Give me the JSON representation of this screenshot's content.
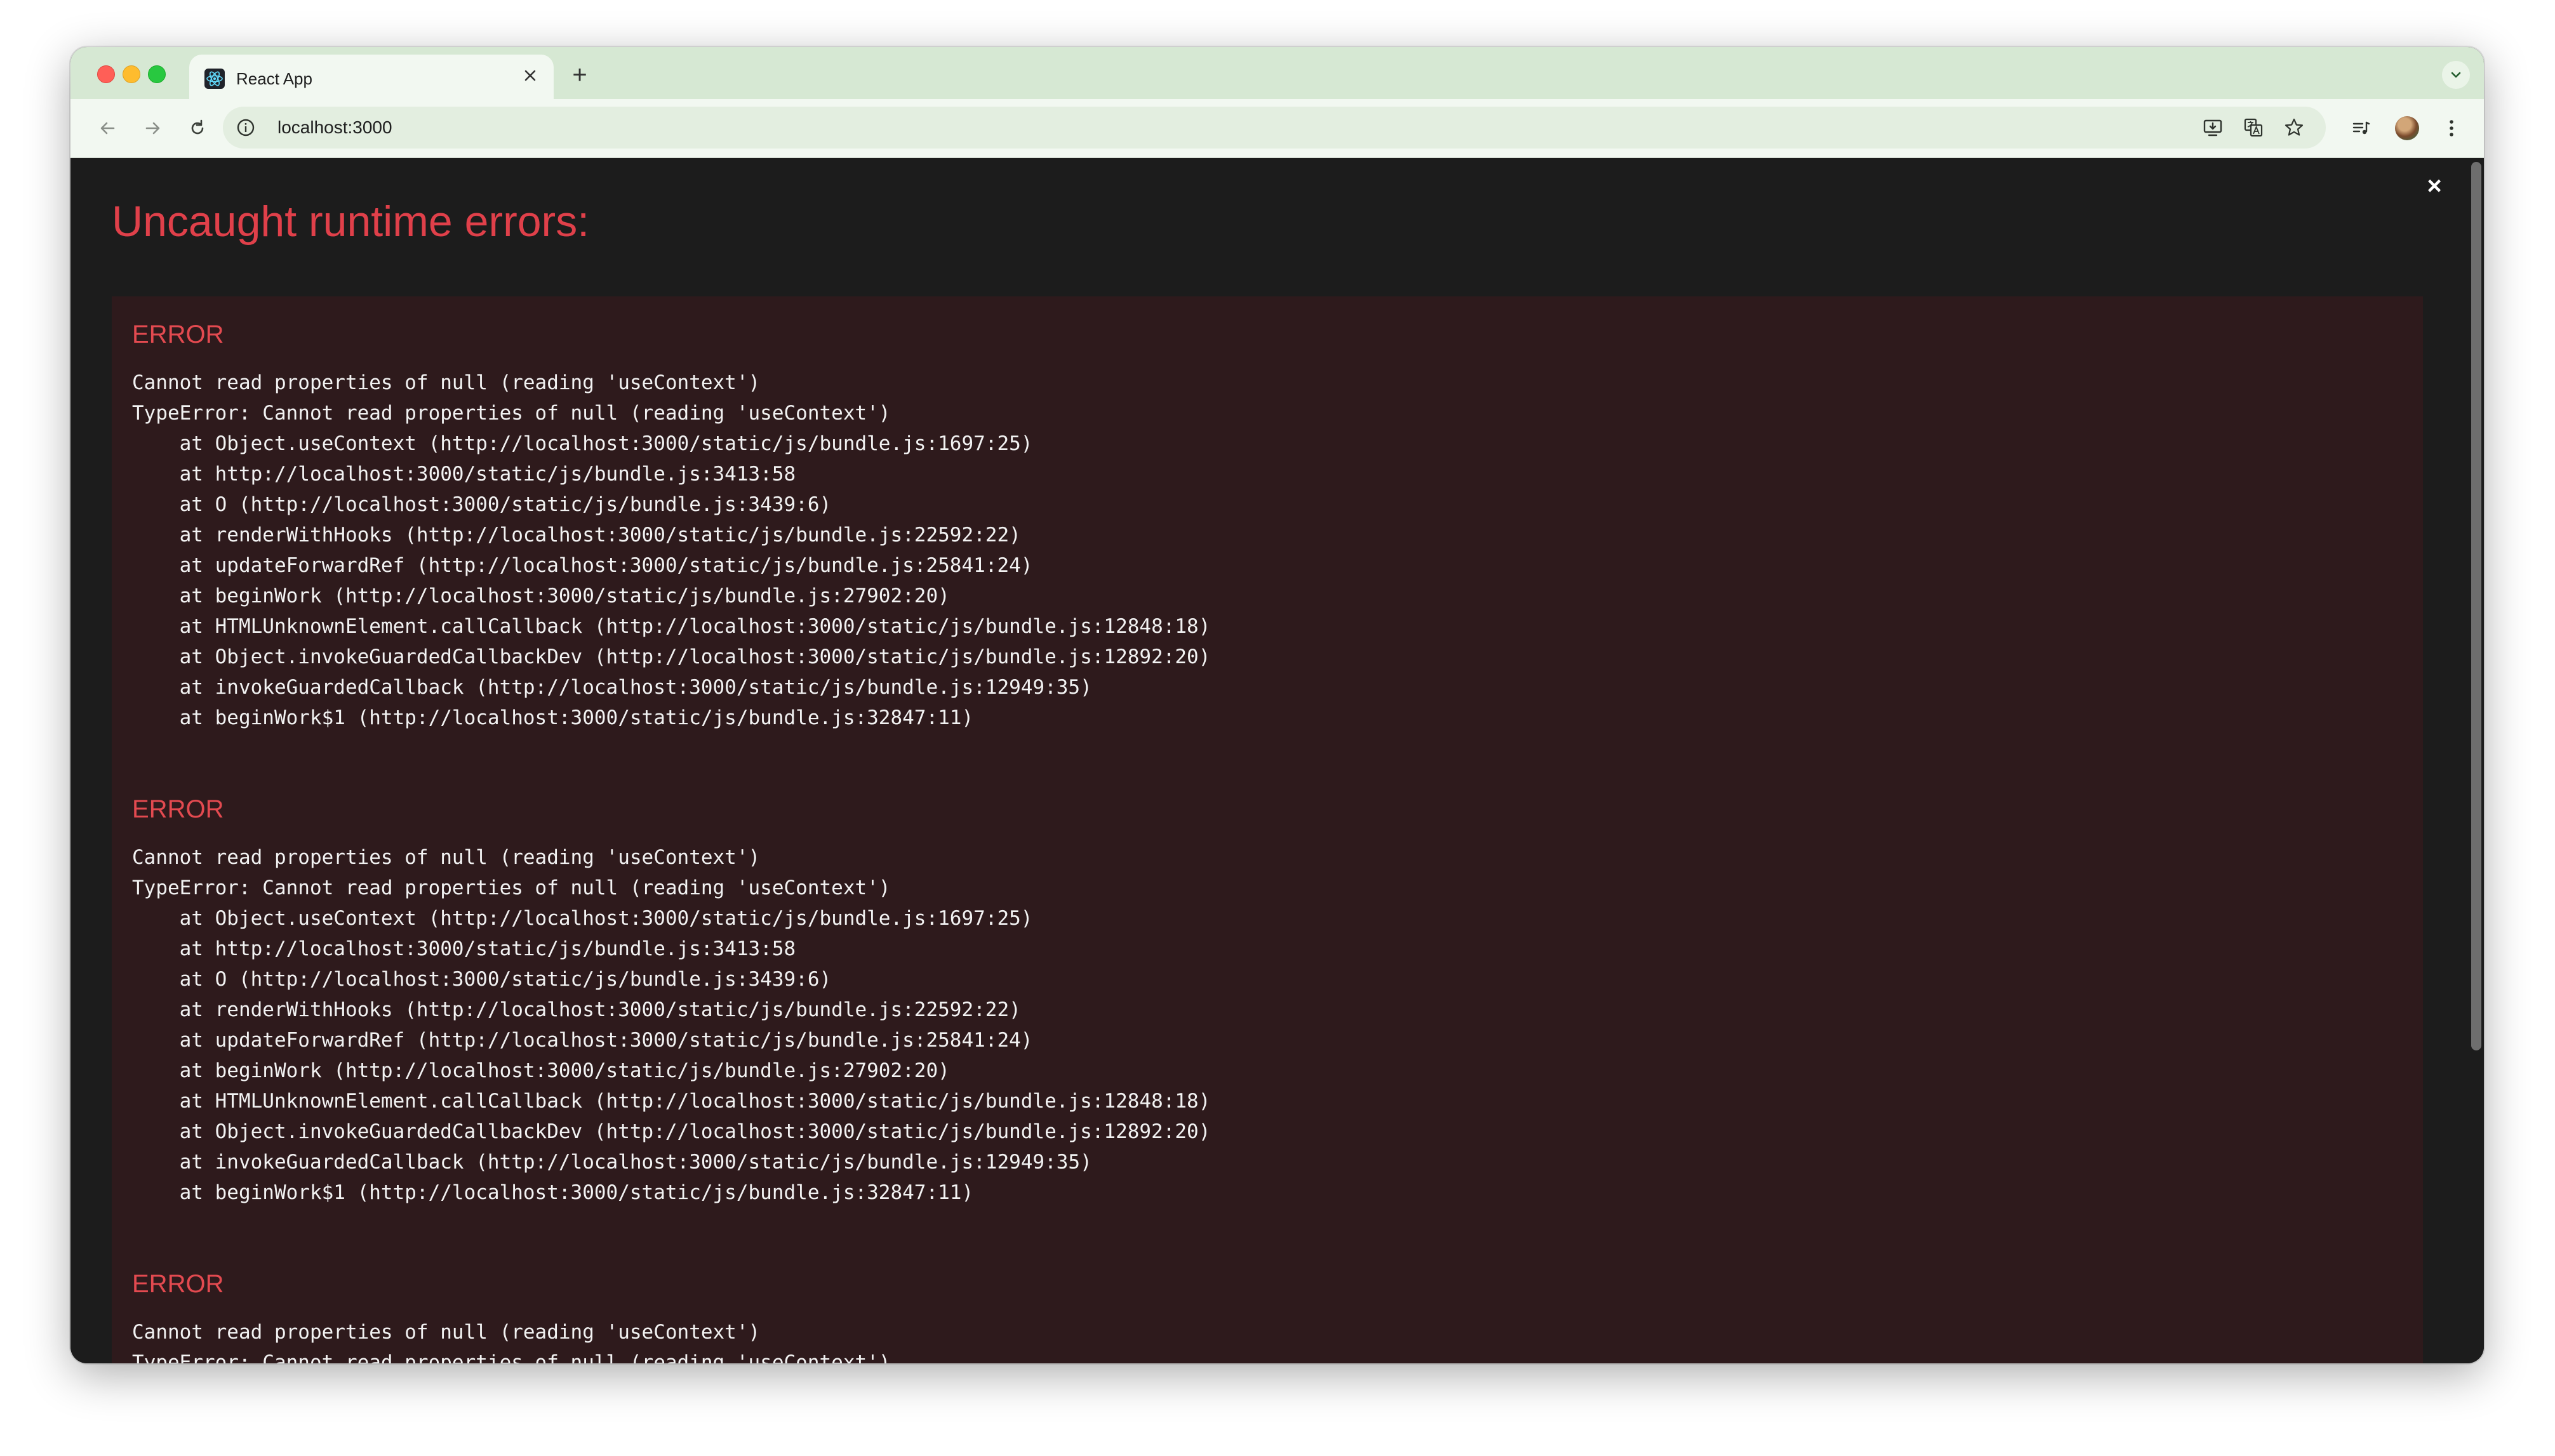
{
  "browser": {
    "tab": {
      "title": "React App",
      "favicon": "react-logo-icon"
    },
    "new_tab_label": "+",
    "address": "localhost:3000",
    "icons": {
      "back": "back-arrow-icon",
      "forward": "forward-arrow-icon",
      "reload": "reload-icon",
      "site_info": "info-icon",
      "install": "install-app-icon",
      "translate": "translate-icon",
      "bookmark": "star-icon",
      "reading_list": "reading-list-icon",
      "profile": "avatar",
      "menu": "kebab-menu-icon"
    }
  },
  "overlay": {
    "title": "Uncaught runtime errors:",
    "close_label": "×",
    "errors": [
      {
        "heading": "ERROR",
        "message": "Cannot read properties of null (reading 'useContext')",
        "type_line": "TypeError: Cannot read properties of null (reading 'useContext')",
        "stack": [
          "    at Object.useContext (http://localhost:3000/static/js/bundle.js:1697:25)",
          "    at http://localhost:3000/static/js/bundle.js:3413:58",
          "    at O (http://localhost:3000/static/js/bundle.js:3439:6)",
          "    at renderWithHooks (http://localhost:3000/static/js/bundle.js:22592:22)",
          "    at updateForwardRef (http://localhost:3000/static/js/bundle.js:25841:24)",
          "    at beginWork (http://localhost:3000/static/js/bundle.js:27902:20)",
          "    at HTMLUnknownElement.callCallback (http://localhost:3000/static/js/bundle.js:12848:18)",
          "    at Object.invokeGuardedCallbackDev (http://localhost:3000/static/js/bundle.js:12892:20)",
          "    at invokeGuardedCallback (http://localhost:3000/static/js/bundle.js:12949:35)",
          "    at beginWork$1 (http://localhost:3000/static/js/bundle.js:32847:11)"
        ]
      },
      {
        "heading": "ERROR",
        "message": "Cannot read properties of null (reading 'useContext')",
        "type_line": "TypeError: Cannot read properties of null (reading 'useContext')",
        "stack": [
          "    at Object.useContext (http://localhost:3000/static/js/bundle.js:1697:25)",
          "    at http://localhost:3000/static/js/bundle.js:3413:58",
          "    at O (http://localhost:3000/static/js/bundle.js:3439:6)",
          "    at renderWithHooks (http://localhost:3000/static/js/bundle.js:22592:22)",
          "    at updateForwardRef (http://localhost:3000/static/js/bundle.js:25841:24)",
          "    at beginWork (http://localhost:3000/static/js/bundle.js:27902:20)",
          "    at HTMLUnknownElement.callCallback (http://localhost:3000/static/js/bundle.js:12848:18)",
          "    at Object.invokeGuardedCallbackDev (http://localhost:3000/static/js/bundle.js:12892:20)",
          "    at invokeGuardedCallback (http://localhost:3000/static/js/bundle.js:12949:35)",
          "    at beginWork$1 (http://localhost:3000/static/js/bundle.js:32847:11)"
        ]
      },
      {
        "heading": "ERROR",
        "message": "Cannot read properties of null (reading 'useContext')",
        "type_line": "TypeError: Cannot read properties of null (reading 'useContext')",
        "stack": []
      }
    ]
  },
  "colors": {
    "tab_strip": "#d6e8d3",
    "toolbar": "#f2f8f1",
    "overlay_bg": "#1c1c1c",
    "error_area_bg": "#2e1a1c",
    "error_red": "#e34a50",
    "title_red": "#e0404a"
  }
}
